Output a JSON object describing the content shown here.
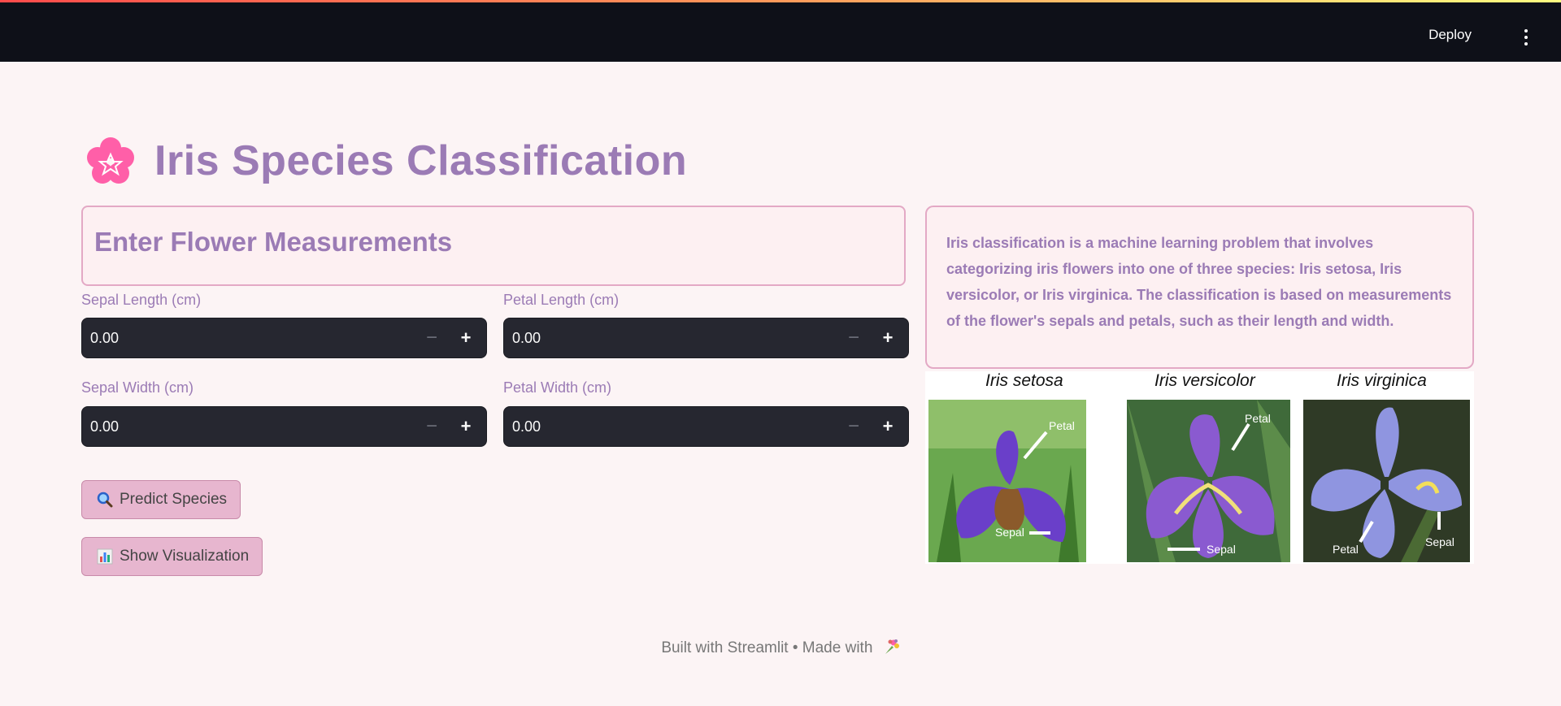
{
  "header": {
    "deploy_label": "Deploy",
    "menu_icon": "kebab-menu-icon"
  },
  "title": {
    "icon": "cherry-blossom-icon",
    "text": "Iris Species Classification"
  },
  "form": {
    "heading": "Enter Flower Measurements",
    "fields": [
      {
        "label": "Sepal Length (cm)",
        "value": "0.00"
      },
      {
        "label": "Petal Length (cm)",
        "value": "0.00"
      },
      {
        "label": "Sepal Width (cm)",
        "value": "0.00"
      },
      {
        "label": "Petal Width (cm)",
        "value": "0.00"
      }
    ],
    "predict_label": "Predict Species",
    "predict_icon": "magnifying-glass-icon",
    "visualize_label": "Show Visualization",
    "visualize_icon": "bar-chart-icon"
  },
  "info": {
    "text": "Iris classification is a machine learning problem that involves categorizing iris flowers into one of three species: Iris setosa, Iris versicolor, or Iris virginica. The classification is based on measurements of the flower's sepals and petals, such as their length and width."
  },
  "figure": {
    "species": [
      "Iris setosa",
      "Iris versicolor",
      "Iris virginica"
    ],
    "labels": {
      "petal": "Petal",
      "sepal": "Sepal"
    }
  },
  "footer": {
    "text": "Built with Streamlit • Made with",
    "icon": "bouquet-icon"
  },
  "colors": {
    "accent": "#9b7bb5",
    "border": "#e3a9c5",
    "button": "#e7b6cf",
    "input_bg": "#262730"
  }
}
